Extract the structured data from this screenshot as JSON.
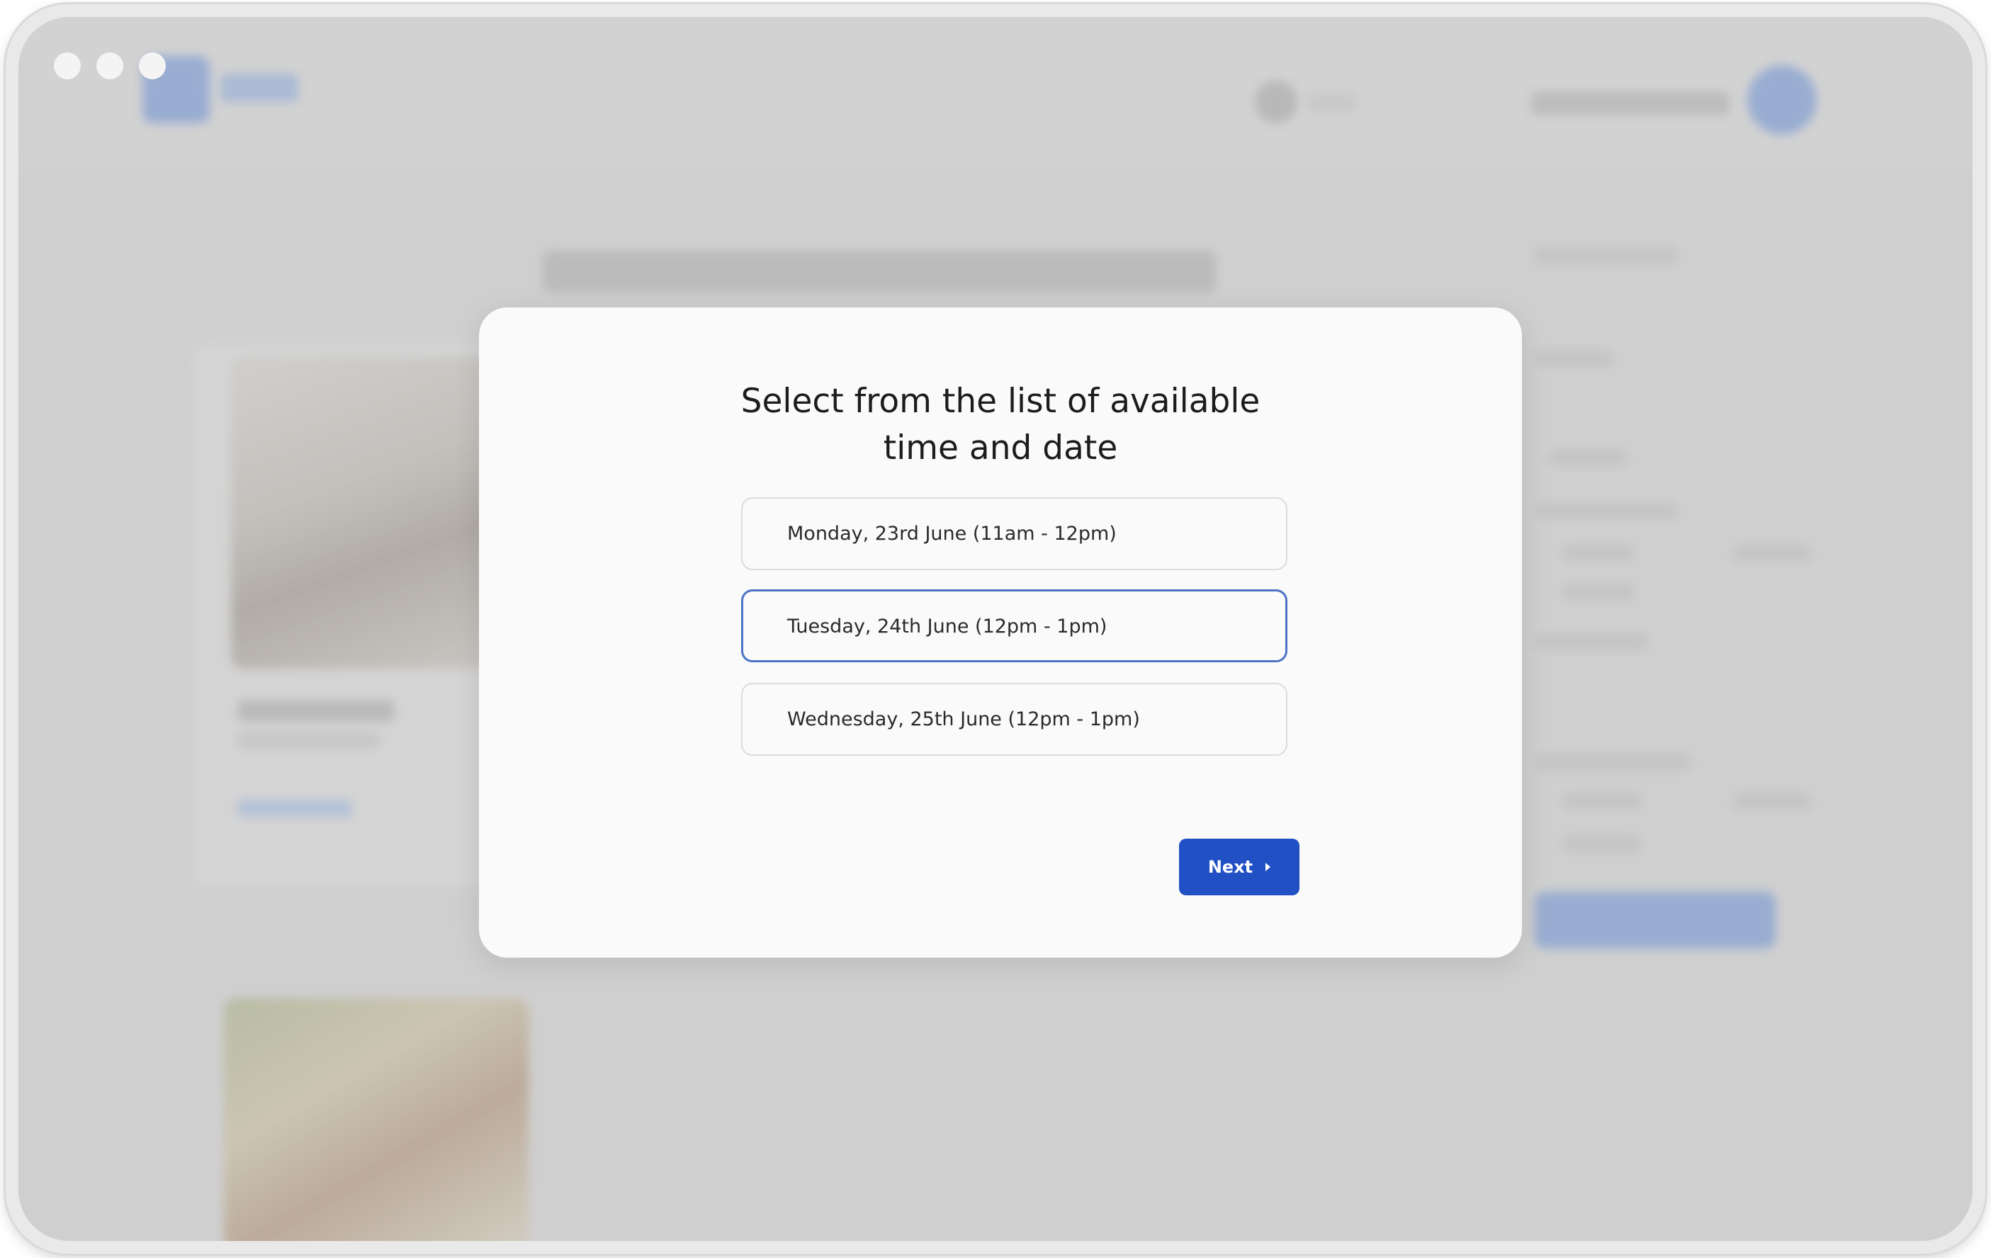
{
  "modal": {
    "title_line1": "Select from the list of available",
    "title_line2": "time and date",
    "options": [
      {
        "label": "Monday, 23rd June (11am - 12pm)",
        "selected": false
      },
      {
        "label": "Tuesday, 24th June (12pm - 1pm)",
        "selected": true
      },
      {
        "label": "Wednesday, 25th June (12pm - 1pm)",
        "selected": false
      }
    ],
    "next_label": "Next",
    "next_icon": "chevron-right-icon"
  },
  "colors": {
    "accent": "#2150c4",
    "selected_border": "#4b72c6",
    "backdrop": "#d2d2d2",
    "modal_bg": "#fafafa"
  }
}
